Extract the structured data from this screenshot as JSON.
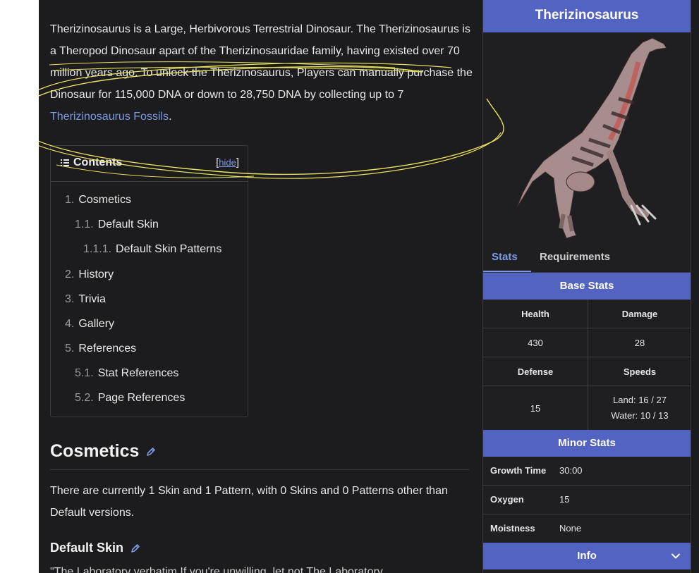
{
  "intro": {
    "text": "Therizinosaurus is a Large, Herbivorous Terrestrial Dinosaur. The Therizinosaurus is a Theropod Dinosaur apart of the Therizinosauridae family, having existed over 70 million years ago. To unlock the Therizinosaurus, Players can manually purchase the Dinosaur for 115,000 DNA or down to 28,750 DNA by collecting up to 7 ",
    "link": "Therizinosaurus Fossils",
    "end": "."
  },
  "toc": {
    "title": "Contents",
    "hide_open": "[",
    "hide_link": "hide",
    "hide_close": "]",
    "items": [
      {
        "num": "1.",
        "label": "Cosmetics"
      },
      {
        "num": "1.1.",
        "label": "Default Skin"
      },
      {
        "num": "1.1.1.",
        "label": "Default Skin Patterns"
      },
      {
        "num": "2.",
        "label": "History"
      },
      {
        "num": "3.",
        "label": "Trivia"
      },
      {
        "num": "4.",
        "label": "Gallery"
      },
      {
        "num": "5.",
        "label": "References"
      },
      {
        "num": "5.1.",
        "label": "Stat References"
      },
      {
        "num": "5.2.",
        "label": "Page References"
      }
    ]
  },
  "cosmetics": {
    "heading": "Cosmetics",
    "text": "There are currently 1 Skin and 1 Pattern, with 0 Skins and 0 Patterns other than Default versions.",
    "subheading": "Default Skin",
    "cut_text": "\"The Laboratory verbatim If you're unwilling, let not The Laboratory..."
  },
  "infobox": {
    "title": "Therizinosaurus",
    "tabs": {
      "stats": "Stats",
      "requirements": "Requirements"
    },
    "base_stats": {
      "heading": "Base Stats",
      "health_label": "Health",
      "damage_label": "Damage",
      "health": "430",
      "damage": "28",
      "defense_label": "Defense",
      "speeds_label": "Speeds",
      "defense": "15",
      "speed_land": "Land: 16 / 27",
      "speed_water": "Water: 10 / 13"
    },
    "minor_stats": {
      "heading": "Minor Stats",
      "rows": [
        {
          "k": "Growth Time",
          "v": "30:00"
        },
        {
          "k": "Oxygen",
          "v": "15"
        },
        {
          "k": "Moistness",
          "v": "None"
        }
      ]
    },
    "info": "Info"
  },
  "colors": {
    "accent": "#5363c1",
    "link": "#7b9be6",
    "background": "#1c1b1d",
    "annotation": "#e8e060"
  }
}
